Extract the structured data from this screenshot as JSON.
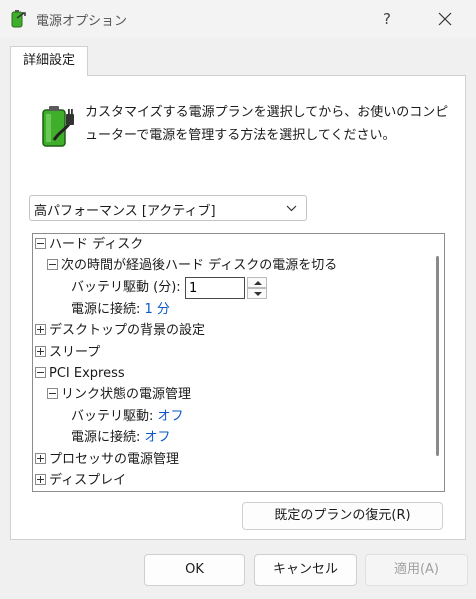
{
  "window": {
    "title": "電源オプション",
    "help_label": "?"
  },
  "tab": {
    "label": "詳細設定"
  },
  "description": "カスタマイズする電源プランを選択してから、お使いのコンピューターで電源を管理する方法を選択してください。",
  "plan_select": {
    "value": "高パフォーマンス [アクティブ]"
  },
  "tree": {
    "hard_disk": "ハード ディスク",
    "turn_off_after": "次の時間が経過後ハード ディスクの電源を切る",
    "battery_minutes_label": "バッテリ駆動 (分):",
    "battery_minutes_value": "1",
    "plugged_in_label": "電源に接続:",
    "plugged_in_value": "1 分",
    "desktop_background": "デスクトップの背景の設定",
    "sleep": "スリープ",
    "pci_express": "PCI Express",
    "link_state": "リンク状態の電源管理",
    "link_battery_label": "バッテリ駆動:",
    "link_battery_value": "オフ",
    "link_plugged_label": "電源に接続:",
    "link_plugged_value": "オフ",
    "processor": "プロセッサの電源管理",
    "display": "ディスプレイ"
  },
  "buttons": {
    "restore": "既定のプランの復元(R)",
    "ok": "OK",
    "cancel": "キャンセル",
    "apply": "適用(A)"
  },
  "colors": {
    "link": "#0a58ca",
    "battery_green": "#3fae2a"
  },
  "icons": {
    "app": "power-options-icon",
    "battery": "battery-plug-icon",
    "close": "close-icon",
    "dropdown": "chevron-down-icon"
  }
}
